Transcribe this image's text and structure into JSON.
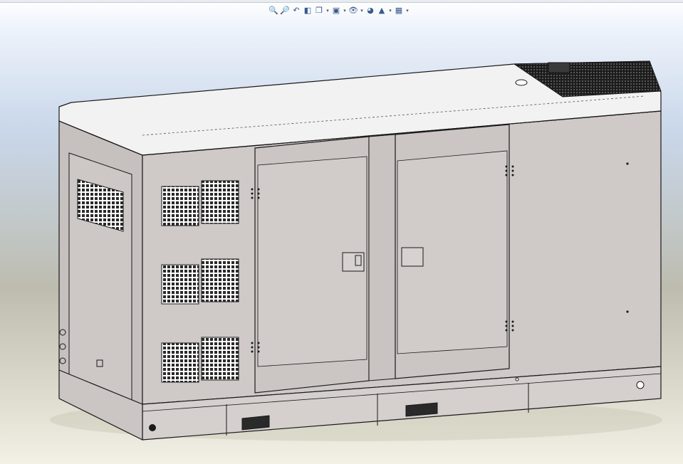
{
  "toolbar": {
    "buttons": [
      {
        "name": "zoom-to-fit-icon",
        "glyph": "🔍"
      },
      {
        "name": "zoom-to-area-icon",
        "glyph": "🔎"
      },
      {
        "name": "previous-view-icon",
        "glyph": "↶"
      },
      {
        "name": "section-view-icon",
        "glyph": "◧"
      },
      {
        "name": "view-orientation-icon",
        "glyph": "❐",
        "dropdown": true
      },
      {
        "name": "display-style-icon",
        "glyph": "▣",
        "dropdown": true
      },
      {
        "name": "hide-show-items-icon",
        "glyph": "👁",
        "dropdown": true
      },
      {
        "name": "edit-appearance-icon",
        "glyph": "◕"
      },
      {
        "name": "apply-scene-icon",
        "glyph": "▲",
        "dropdown": true
      },
      {
        "name": "view-settings-icon",
        "glyph": "▦",
        "dropdown": true
      }
    ],
    "dropdown_glyph": "▾"
  },
  "colors": {
    "body": "#cfc9c8",
    "body_dark": "#b9b3b2",
    "roof": "#f2f2f2",
    "outline": "#1a1a1a",
    "vent": "#222222"
  }
}
